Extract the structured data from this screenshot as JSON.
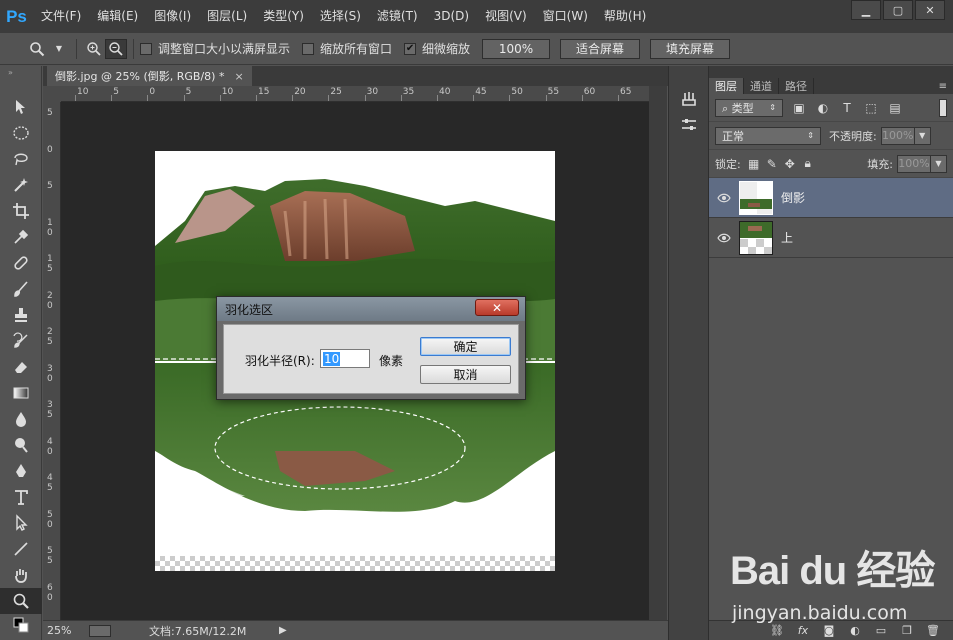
{
  "app": {
    "logo": "Ps"
  },
  "menu": [
    "文件(F)",
    "编辑(E)",
    "图像(I)",
    "图层(L)",
    "类型(Y)",
    "选择(S)",
    "滤镜(T)",
    "3D(D)",
    "视图(V)",
    "窗口(W)",
    "帮助(H)"
  ],
  "options": {
    "resize_windows_label": "调整窗口大小以满屏显示",
    "zoom_all_label": "缩放所有窗口",
    "scrubby_zoom_label": "细微缩放",
    "btn_100": "100%",
    "btn_fit": "适合屏幕",
    "btn_fill": "填充屏幕"
  },
  "document": {
    "tab_title": "倒影.jpg @ 25% (倒影, RGB/8) *",
    "close": "×"
  },
  "ruler_top": [
    "10",
    "5",
    "0",
    "5",
    "10",
    "15",
    "20",
    "25",
    "30",
    "35",
    "40",
    "45",
    "50",
    "55",
    "60",
    "65"
  ],
  "ruler_left": [
    "5",
    "0",
    "5",
    "1\n0",
    "1\n5",
    "2\n0",
    "2\n5",
    "3\n0",
    "3\n5",
    "4\n0",
    "4\n5",
    "5\n0",
    "5\n5",
    "6\n0"
  ],
  "status": {
    "zoom": "25%",
    "doc": "文档:7.65M/12.2M"
  },
  "layers_panel": {
    "tabs": [
      "图层",
      "通道",
      "路径"
    ],
    "filter_kind": "类型",
    "blend_mode": "正常",
    "opacity_label": "不透明度:",
    "opacity_value": "100%",
    "lock_label": "锁定:",
    "fill_label": "填充:",
    "fill_value": "100%",
    "layers": [
      {
        "name": "倒影",
        "selected": true
      },
      {
        "name": "上",
        "selected": false
      }
    ]
  },
  "dialog": {
    "title": "羽化选区",
    "radius_label": "羽化半径(R):",
    "radius_value": "10",
    "unit": "像素",
    "ok": "确定",
    "cancel": "取消"
  },
  "watermark": {
    "logo": "Bai du 经验",
    "url": "jingyan.baidu.com"
  }
}
